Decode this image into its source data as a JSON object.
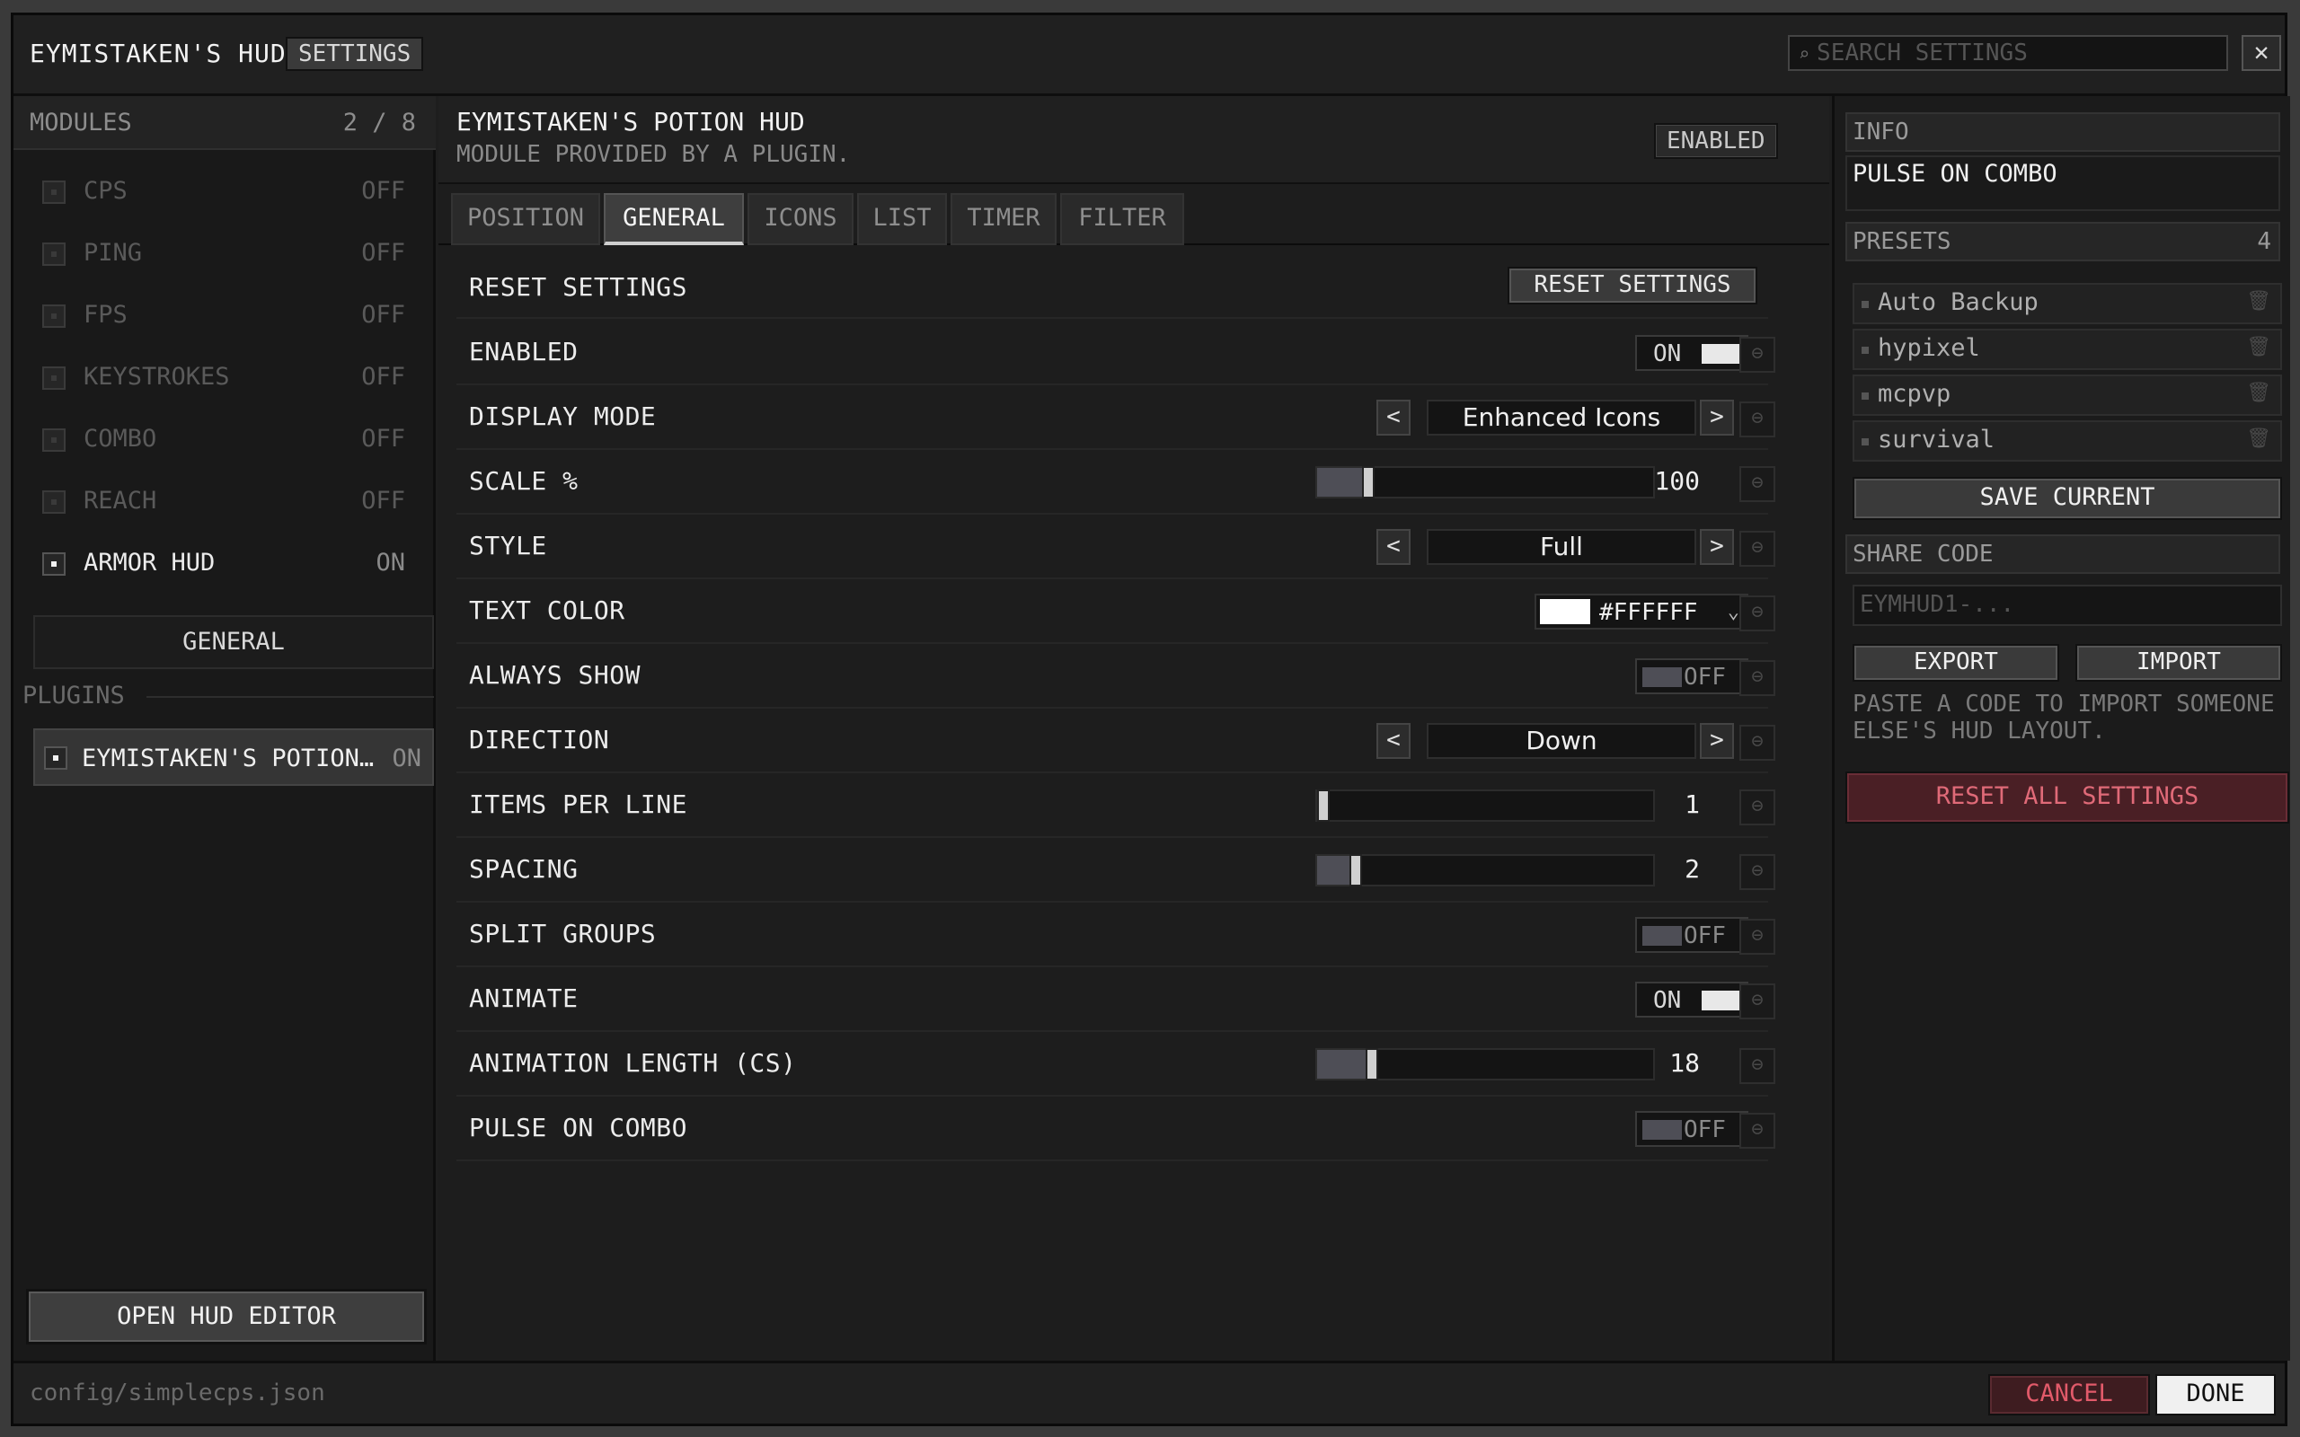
{
  "titlebar": {
    "app_title": "EYMISTAKEN'S HUD",
    "settings_badge": "SETTINGS",
    "search_placeholder": "SEARCH SETTINGS",
    "close_label": "✕"
  },
  "sidebar": {
    "header_label": "MODULES",
    "header_count": "2 / 8",
    "modules": [
      {
        "name": "CPS",
        "state": "OFF",
        "on": false
      },
      {
        "name": "PING",
        "state": "OFF",
        "on": false
      },
      {
        "name": "FPS",
        "state": "OFF",
        "on": false
      },
      {
        "name": "KEYSTROKES",
        "state": "OFF",
        "on": false
      },
      {
        "name": "COMBO",
        "state": "OFF",
        "on": false
      },
      {
        "name": "REACH",
        "state": "OFF",
        "on": false
      },
      {
        "name": "ARMOR HUD",
        "state": "ON",
        "on": true
      }
    ],
    "general_label": "GENERAL",
    "plugins_header": "PLUGINS",
    "plugin": {
      "name": "EYMISTAKEN'S POTION…",
      "state": "ON"
    },
    "open_editor_label": "OPEN HUD EDITOR"
  },
  "module": {
    "title": "EYMISTAKEN'S POTION HUD",
    "subtitle": "MODULE PROVIDED BY A PLUGIN.",
    "status_badge": "ENABLED",
    "tabs": [
      "POSITION",
      "GENERAL",
      "ICONS",
      "LIST",
      "TIMER",
      "FILTER"
    ],
    "active_tab": "GENERAL"
  },
  "settings": {
    "reset": {
      "label": "RESET SETTINGS",
      "button": "RESET SETTINGS"
    },
    "enabled": {
      "label": "ENABLED",
      "value": "ON"
    },
    "display_mode": {
      "label": "DISPLAY MODE",
      "value": "Enhanced Icons"
    },
    "scale": {
      "label": "SCALE %",
      "value": "100",
      "fraction": 0.14
    },
    "style": {
      "label": "STYLE",
      "value": "Full"
    },
    "text_color": {
      "label": "TEXT COLOR",
      "value": "#FFFFFF",
      "swatch": "#ffffff"
    },
    "always_show": {
      "label": "ALWAYS SHOW",
      "value": "OFF"
    },
    "direction": {
      "label": "DIRECTION",
      "value": "Down"
    },
    "items_per_line": {
      "label": "ITEMS PER LINE",
      "value": "1",
      "fraction": 0.0
    },
    "spacing": {
      "label": "SPACING",
      "value": "2",
      "fraction": 0.1
    },
    "split_groups": {
      "label": "SPLIT GROUPS",
      "value": "OFF"
    },
    "animate": {
      "label": "ANIMATE",
      "value": "ON"
    },
    "animation_length": {
      "label": "ANIMATION LENGTH (CS)",
      "value": "18",
      "fraction": 0.15
    },
    "pulse_on_combo": {
      "label": "PULSE ON COMBO",
      "value": "OFF"
    }
  },
  "right": {
    "info_header": "INFO",
    "info_text": "PULSE ON COMBO",
    "presets_header": "PRESETS",
    "presets_count": "4",
    "presets": [
      "Auto Backup",
      "hypixel",
      "mcpvp",
      "survival"
    ],
    "save_current": "SAVE CURRENT",
    "share_header": "SHARE CODE",
    "share_placeholder": "EYMHUD1-...",
    "export_label": "EXPORT",
    "import_label": "IMPORT",
    "share_hint": "PASTE A CODE TO IMPORT SOMEONE ELSE'S HUD LAYOUT.",
    "reset_all": "RESET ALL SETTINGS"
  },
  "footer": {
    "path": "config/simplecps.json",
    "cancel_label": "CANCEL",
    "done_label": "DONE"
  },
  "colors": {
    "accent_danger": "#e25a6a",
    "slider_fill": "#4e4e56",
    "background": "#1e1e1e"
  }
}
